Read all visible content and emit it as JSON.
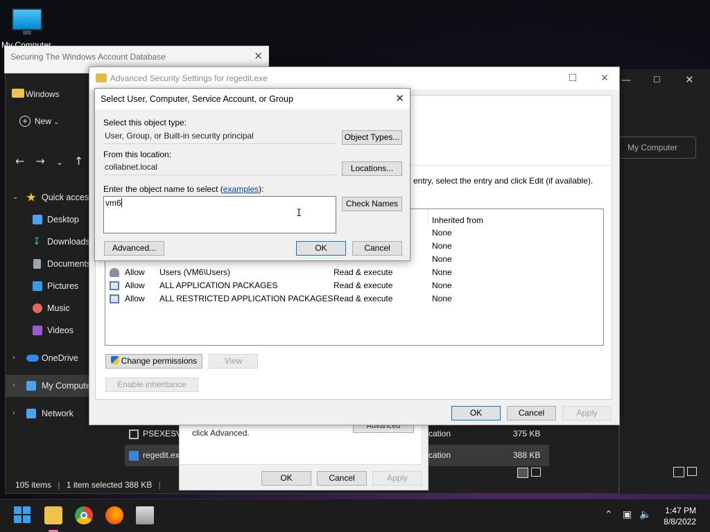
{
  "desktop": {
    "icon_label": "My Computer"
  },
  "explorer": {
    "title": "Windows",
    "new_label": "New",
    "sidebar": [
      {
        "label": "Quick access",
        "icon": "star-icon",
        "color": "#f5c518"
      },
      {
        "label": "Desktop",
        "icon": "desktop-icon",
        "color": "#4aa3f0"
      },
      {
        "label": "Downloads",
        "icon": "download-icon",
        "color": "#3fbf72"
      },
      {
        "label": "Documents",
        "icon": "document-icon",
        "color": "#9aa5b1"
      },
      {
        "label": "Pictures",
        "icon": "pictures-icon",
        "color": "#3a9be0"
      },
      {
        "label": "Music",
        "icon": "music-icon",
        "color": "#e06a5a"
      },
      {
        "label": "Videos",
        "icon": "videos-icon",
        "color": "#9b59d0"
      },
      {
        "label": "OneDrive",
        "icon": "cloud-icon",
        "color": "#2f8be6"
      },
      {
        "label": "My Computer",
        "icon": "computer-icon",
        "color": "#4aa3f0"
      },
      {
        "label": "Network",
        "icon": "network-icon",
        "color": "#4aa3f0"
      }
    ],
    "location_button": "My Computer",
    "rows": [
      {
        "name": "PSEXESVC",
        "type": "cation",
        "size": "375 KB"
      },
      {
        "name": "regedit.exe",
        "type": "cation",
        "size": "388 KB"
      }
    ],
    "status": {
      "items": "105 items",
      "selected": "1 item selected  388 KB"
    }
  },
  "secwin": {
    "title": "Securing The Windows Account Database"
  },
  "permwin": {
    "text": "click Advanced.",
    "advanced_label": "Advanced",
    "ok": "OK",
    "cancel": "Cancel",
    "apply": "Apply"
  },
  "advwin": {
    "title": "Advanced Security Settings for regedit.exe",
    "instruction": "entry, select the entry and click Edit (if available).",
    "col_inherited": "Inherited from",
    "rows": [
      {
        "type": "",
        "principal": "",
        "access": "",
        "inherited": "None"
      },
      {
        "type": "",
        "principal": "",
        "access": "",
        "inherited": "None"
      },
      {
        "type": "",
        "principal": "",
        "access": "",
        "inherited": "None"
      },
      {
        "type": "Allow",
        "principal": "Users (VM6\\Users)",
        "access": "Read & execute",
        "inherited": "None"
      },
      {
        "type": "Allow",
        "principal": "ALL APPLICATION PACKAGES",
        "access": "Read & execute",
        "inherited": "None"
      },
      {
        "type": "Allow",
        "principal": "ALL RESTRICTED APPLICATION PACKAGES",
        "access": "Read & execute",
        "inherited": "None"
      }
    ],
    "change_permissions": "Change permissions",
    "view": "View",
    "enable_inheritance": "Enable inheritance",
    "ok": "OK",
    "cancel": "Cancel",
    "apply": "Apply"
  },
  "select_dialog": {
    "title": "Select User, Computer, Service Account, or Group",
    "object_type_label": "Select this object type:",
    "object_type_value": "User, Group, or Built-in security principal",
    "object_types_button": "Object Types...",
    "location_label": "From this location:",
    "location_value": "collabnet.local",
    "locations_button": "Locations...",
    "name_label_prefix": "Enter the object name to select (",
    "name_label_link": "examples",
    "name_label_suffix": "):",
    "name_value": "vm6",
    "check_names_button": "Check Names",
    "advanced_button": "Advanced...",
    "ok": "OK",
    "cancel": "Cancel"
  },
  "taskbar": {
    "time": "1:47 PM",
    "date": "8/8/2022"
  }
}
